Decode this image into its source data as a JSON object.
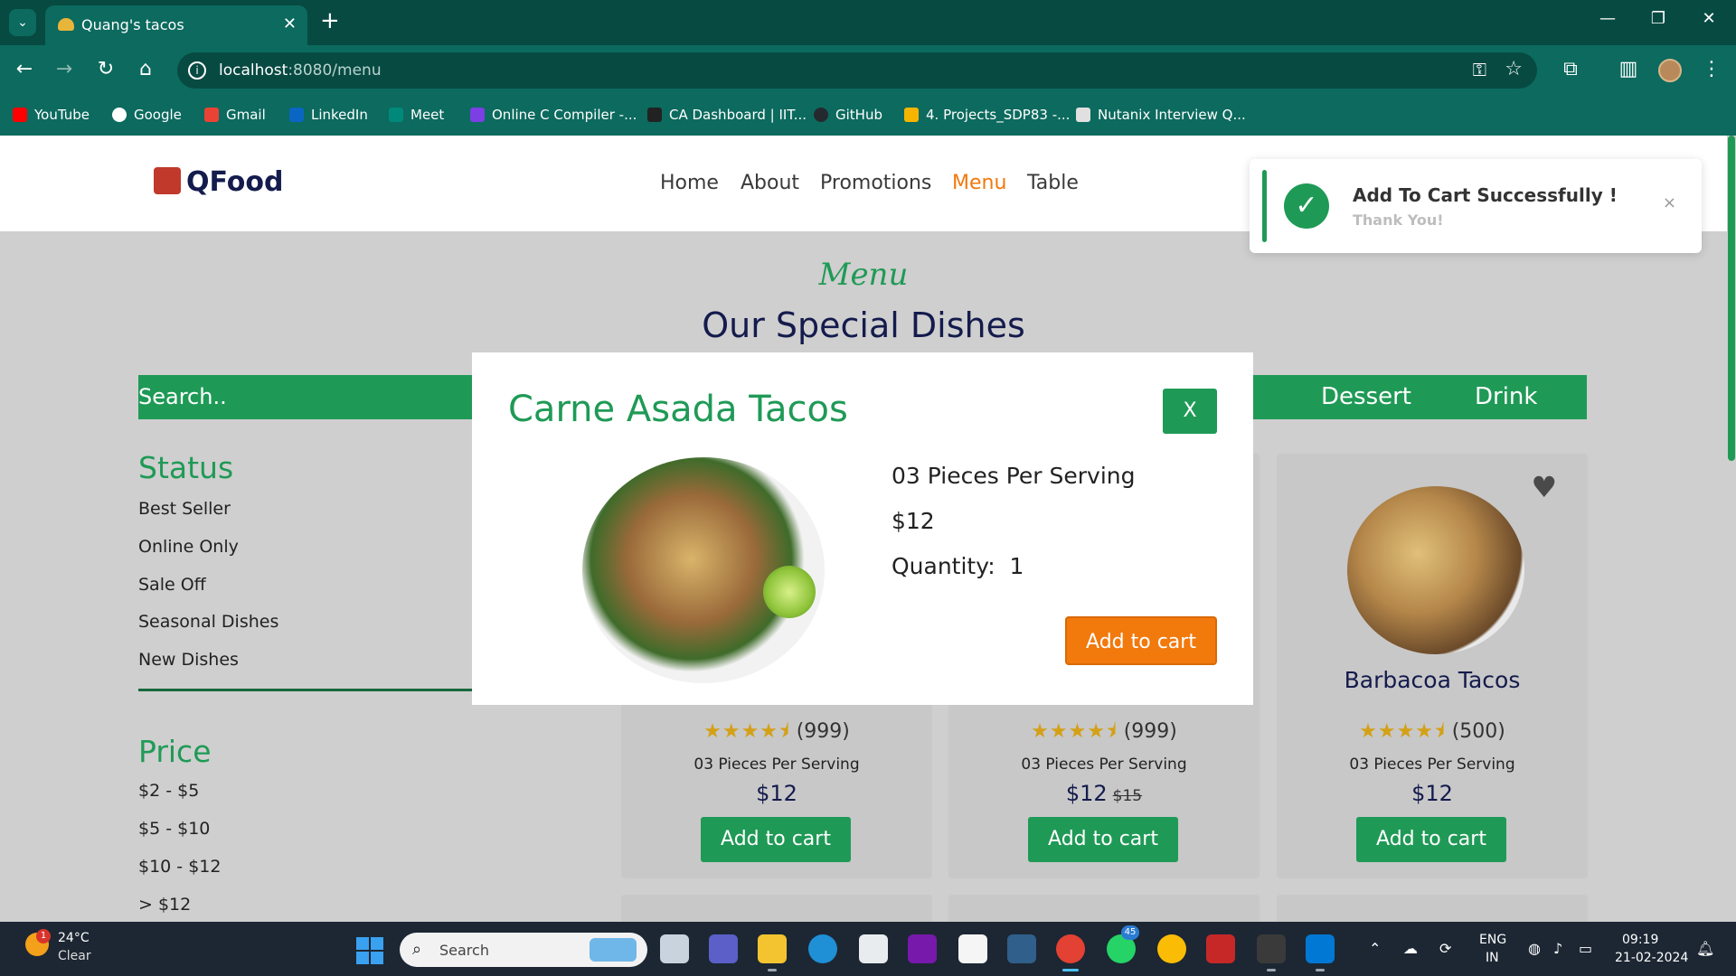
{
  "browser": {
    "tab_title": "Quang's tacos",
    "tab_close": "✕",
    "new_tab": "+",
    "menu_chevron": "⌄",
    "url_host": "localhost",
    "url_path": ":8080/menu",
    "window_controls": [
      "—",
      "❐",
      "✕"
    ],
    "bookmarks": [
      {
        "label": "YouTube",
        "color": "#ff0000"
      },
      {
        "label": "Google",
        "color": "#ffffff"
      },
      {
        "label": "Gmail",
        "color": "#ea4335"
      },
      {
        "label": "LinkedIn",
        "color": "#0a66c2"
      },
      {
        "label": "Meet",
        "color": "#00897b"
      },
      {
        "label": "Online C Compiler -...",
        "color": "#7b3fe4"
      },
      {
        "label": "CA Dashboard | IIT...",
        "color": "#222222"
      },
      {
        "label": "GitHub",
        "color": "#24292f"
      },
      {
        "label": "4. Projects_SDP83 -...",
        "color": "#f4b400"
      },
      {
        "label": "Nutanix Interview Q...",
        "color": "#e0e0e0"
      }
    ]
  },
  "site": {
    "logo": "QFood",
    "nav": [
      "Home",
      "About",
      "Promotions",
      "Menu",
      "Table"
    ],
    "active_nav": "Menu",
    "toast": {
      "title": "Add To Cart Successfully !",
      "subtitle": "Thank You!",
      "close": "×"
    },
    "script_heading": "Menu",
    "section_title": "Our Special Dishes",
    "search_placeholder": "Search..",
    "categories_visible": [
      "Dessert",
      "Drink"
    ],
    "sidebar": {
      "status_heading": "Status",
      "status_items": [
        "Best Seller",
        "Online Only",
        "Sale Off",
        "Seasonal Dishes",
        "New Dishes"
      ],
      "price_heading": "Price",
      "price_items": [
        "$2 - $5",
        "$5 - $10",
        "$10 - $12",
        "> $12"
      ]
    },
    "cards": [
      {
        "name": "",
        "stars": "★★★★⯨",
        "reviews": "(999)",
        "serving": "03 Pieces Per Serving",
        "price": "$12",
        "old_price": "",
        "button": "Add to cart"
      },
      {
        "name": "",
        "stars": "★★★★⯨",
        "reviews": "(999)",
        "serving": "03 Pieces Per Serving",
        "price": "$12",
        "old_price": "$15",
        "button": "Add to cart"
      },
      {
        "name": "Barbacoa Tacos",
        "stars": "★★★★⯨",
        "reviews": "(500)",
        "serving": "03 Pieces Per Serving",
        "price": "$12",
        "old_price": "",
        "button": "Add to cart"
      }
    ],
    "modal": {
      "title": "Carne Asada Tacos",
      "close": "X",
      "serving": "03 Pieces Per Serving",
      "price": "$12",
      "quantity_label": "Quantity:",
      "quantity_value": "1",
      "add_button": "Add to cart"
    }
  },
  "taskbar": {
    "weather_temp": "24°C",
    "weather_cond": "Clear",
    "weather_badge": "1",
    "search_label": "Search",
    "whatsapp_badge": "45",
    "lang_top": "ENG",
    "lang_bottom": "IN",
    "time": "09:19",
    "date": "21-02-2024"
  },
  "colors": {
    "accent_green": "#1f9a56",
    "accent_orange": "#f2790c",
    "navy": "#141b4d",
    "chrome": "#0c6a5e"
  }
}
